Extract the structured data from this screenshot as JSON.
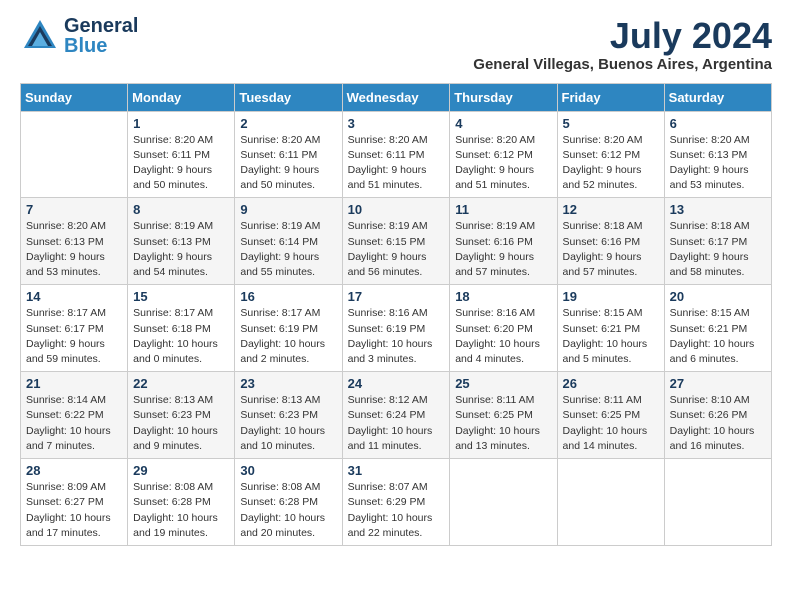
{
  "header": {
    "logo_general": "General",
    "logo_blue": "Blue",
    "title": "July 2024",
    "subtitle": "General Villegas, Buenos Aires, Argentina"
  },
  "days_of_week": [
    "Sunday",
    "Monday",
    "Tuesday",
    "Wednesday",
    "Thursday",
    "Friday",
    "Saturday"
  ],
  "weeks": [
    [
      {
        "day": "",
        "sunrise": "",
        "sunset": "",
        "daylight": ""
      },
      {
        "day": "1",
        "sunrise": "Sunrise: 8:20 AM",
        "sunset": "Sunset: 6:11 PM",
        "daylight": "Daylight: 9 hours and 50 minutes."
      },
      {
        "day": "2",
        "sunrise": "Sunrise: 8:20 AM",
        "sunset": "Sunset: 6:11 PM",
        "daylight": "Daylight: 9 hours and 50 minutes."
      },
      {
        "day": "3",
        "sunrise": "Sunrise: 8:20 AM",
        "sunset": "Sunset: 6:11 PM",
        "daylight": "Daylight: 9 hours and 51 minutes."
      },
      {
        "day": "4",
        "sunrise": "Sunrise: 8:20 AM",
        "sunset": "Sunset: 6:12 PM",
        "daylight": "Daylight: 9 hours and 51 minutes."
      },
      {
        "day": "5",
        "sunrise": "Sunrise: 8:20 AM",
        "sunset": "Sunset: 6:12 PM",
        "daylight": "Daylight: 9 hours and 52 minutes."
      },
      {
        "day": "6",
        "sunrise": "Sunrise: 8:20 AM",
        "sunset": "Sunset: 6:13 PM",
        "daylight": "Daylight: 9 hours and 53 minutes."
      }
    ],
    [
      {
        "day": "7",
        "sunrise": "Sunrise: 8:20 AM",
        "sunset": "Sunset: 6:13 PM",
        "daylight": "Daylight: 9 hours and 53 minutes."
      },
      {
        "day": "8",
        "sunrise": "Sunrise: 8:19 AM",
        "sunset": "Sunset: 6:13 PM",
        "daylight": "Daylight: 9 hours and 54 minutes."
      },
      {
        "day": "9",
        "sunrise": "Sunrise: 8:19 AM",
        "sunset": "Sunset: 6:14 PM",
        "daylight": "Daylight: 9 hours and 55 minutes."
      },
      {
        "day": "10",
        "sunrise": "Sunrise: 8:19 AM",
        "sunset": "Sunset: 6:15 PM",
        "daylight": "Daylight: 9 hours and 56 minutes."
      },
      {
        "day": "11",
        "sunrise": "Sunrise: 8:19 AM",
        "sunset": "Sunset: 6:16 PM",
        "daylight": "Daylight: 9 hours and 57 minutes."
      },
      {
        "day": "12",
        "sunrise": "Sunrise: 8:18 AM",
        "sunset": "Sunset: 6:16 PM",
        "daylight": "Daylight: 9 hours and 57 minutes."
      },
      {
        "day": "13",
        "sunrise": "Sunrise: 8:18 AM",
        "sunset": "Sunset: 6:17 PM",
        "daylight": "Daylight: 9 hours and 58 minutes."
      }
    ],
    [
      {
        "day": "14",
        "sunrise": "Sunrise: 8:17 AM",
        "sunset": "Sunset: 6:17 PM",
        "daylight": "Daylight: 9 hours and 59 minutes."
      },
      {
        "day": "15",
        "sunrise": "Sunrise: 8:17 AM",
        "sunset": "Sunset: 6:18 PM",
        "daylight": "Daylight: 10 hours and 0 minutes."
      },
      {
        "day": "16",
        "sunrise": "Sunrise: 8:17 AM",
        "sunset": "Sunset: 6:19 PM",
        "daylight": "Daylight: 10 hours and 2 minutes."
      },
      {
        "day": "17",
        "sunrise": "Sunrise: 8:16 AM",
        "sunset": "Sunset: 6:19 PM",
        "daylight": "Daylight: 10 hours and 3 minutes."
      },
      {
        "day": "18",
        "sunrise": "Sunrise: 8:16 AM",
        "sunset": "Sunset: 6:20 PM",
        "daylight": "Daylight: 10 hours and 4 minutes."
      },
      {
        "day": "19",
        "sunrise": "Sunrise: 8:15 AM",
        "sunset": "Sunset: 6:21 PM",
        "daylight": "Daylight: 10 hours and 5 minutes."
      },
      {
        "day": "20",
        "sunrise": "Sunrise: 8:15 AM",
        "sunset": "Sunset: 6:21 PM",
        "daylight": "Daylight: 10 hours and 6 minutes."
      }
    ],
    [
      {
        "day": "21",
        "sunrise": "Sunrise: 8:14 AM",
        "sunset": "Sunset: 6:22 PM",
        "daylight": "Daylight: 10 hours and 7 minutes."
      },
      {
        "day": "22",
        "sunrise": "Sunrise: 8:13 AM",
        "sunset": "Sunset: 6:23 PM",
        "daylight": "Daylight: 10 hours and 9 minutes."
      },
      {
        "day": "23",
        "sunrise": "Sunrise: 8:13 AM",
        "sunset": "Sunset: 6:23 PM",
        "daylight": "Daylight: 10 hours and 10 minutes."
      },
      {
        "day": "24",
        "sunrise": "Sunrise: 8:12 AM",
        "sunset": "Sunset: 6:24 PM",
        "daylight": "Daylight: 10 hours and 11 minutes."
      },
      {
        "day": "25",
        "sunrise": "Sunrise: 8:11 AM",
        "sunset": "Sunset: 6:25 PM",
        "daylight": "Daylight: 10 hours and 13 minutes."
      },
      {
        "day": "26",
        "sunrise": "Sunrise: 8:11 AM",
        "sunset": "Sunset: 6:25 PM",
        "daylight": "Daylight: 10 hours and 14 minutes."
      },
      {
        "day": "27",
        "sunrise": "Sunrise: 8:10 AM",
        "sunset": "Sunset: 6:26 PM",
        "daylight": "Daylight: 10 hours and 16 minutes."
      }
    ],
    [
      {
        "day": "28",
        "sunrise": "Sunrise: 8:09 AM",
        "sunset": "Sunset: 6:27 PM",
        "daylight": "Daylight: 10 hours and 17 minutes."
      },
      {
        "day": "29",
        "sunrise": "Sunrise: 8:08 AM",
        "sunset": "Sunset: 6:28 PM",
        "daylight": "Daylight: 10 hours and 19 minutes."
      },
      {
        "day": "30",
        "sunrise": "Sunrise: 8:08 AM",
        "sunset": "Sunset: 6:28 PM",
        "daylight": "Daylight: 10 hours and 20 minutes."
      },
      {
        "day": "31",
        "sunrise": "Sunrise: 8:07 AM",
        "sunset": "Sunset: 6:29 PM",
        "daylight": "Daylight: 10 hours and 22 minutes."
      },
      {
        "day": "",
        "sunrise": "",
        "sunset": "",
        "daylight": ""
      },
      {
        "day": "",
        "sunrise": "",
        "sunset": "",
        "daylight": ""
      },
      {
        "day": "",
        "sunrise": "",
        "sunset": "",
        "daylight": ""
      }
    ]
  ]
}
